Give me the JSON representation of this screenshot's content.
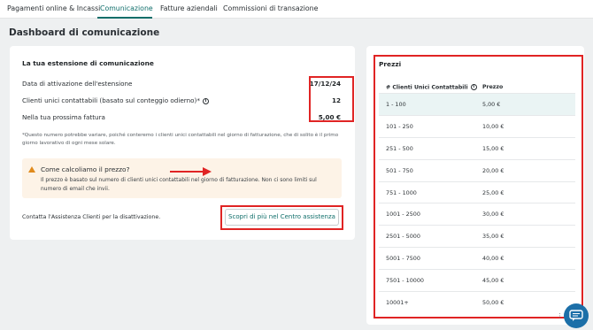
{
  "tabs": [
    {
      "label": "Pagamenti online & Incassi",
      "active": false
    },
    {
      "label": "Comunicazione",
      "active": true
    },
    {
      "label": "Fatture aziendali",
      "active": false
    },
    {
      "label": "Commissioni di transazione",
      "active": false
    }
  ],
  "page_title": "Dashboard di comunicazione",
  "extension": {
    "title": "La tua estensione di comunicazione",
    "rows": [
      {
        "label": "Data di attivazione dell'estensione",
        "value": "17/12/24"
      },
      {
        "label": "Clienti unici contattabili (basato sul conteggio odierno)*",
        "value": "12"
      },
      {
        "label": "Nella tua prossima fattura",
        "value": "5,00 €"
      }
    ],
    "info_glyph": "i",
    "footnote": "*Questo numero potrebbe variare, poiché conteremo i clienti unici contattabili nel giorno di fatturazione, che di solito è il primo giorno lavorativo di ogni mese solare."
  },
  "alert": {
    "icon": "warning-icon",
    "title": "Come calcoliamo il prezzo?",
    "text": "Il prezzo è basato sul numero di clienti unici contattabili nel giorno di fatturazione. Non ci sono limiti sul numero di email che invii."
  },
  "contact": {
    "text": "Contatta l'Assistenza Clienti per la disattivazione.",
    "button_label": "Scopri di più nel Centro assistenza"
  },
  "prices": {
    "title": "Prezzi",
    "columns": [
      "# Clienti Unici Contattabili",
      "Prezzo"
    ],
    "rows": [
      {
        "range": "1 - 100",
        "price": "5,00 €",
        "highlighted": true
      },
      {
        "range": "101 - 250",
        "price": "10,00 €"
      },
      {
        "range": "251 - 500",
        "price": "15,00 €"
      },
      {
        "range": "501 - 750",
        "price": "20,00 €"
      },
      {
        "range": "751 - 1000",
        "price": "25,00 €"
      },
      {
        "range": "1001 - 2500",
        "price": "30,00 €"
      },
      {
        "range": "2501 - 5000",
        "price": "35,00 €"
      },
      {
        "range": "5001 - 7500",
        "price": "40,00 €"
      },
      {
        "range": "7501 - 10000",
        "price": "45,00 €"
      },
      {
        "range": "10001+",
        "price": "50,00 €"
      }
    ]
  },
  "colors": {
    "accent": "#0f6e6a",
    "annotation_red": "#e02424",
    "chat_button": "#1c6fa8",
    "alert_bg": "#fdf3e7",
    "highlight_row": "#eaf4f4"
  },
  "chat_icon": "chat-bubble-icon"
}
